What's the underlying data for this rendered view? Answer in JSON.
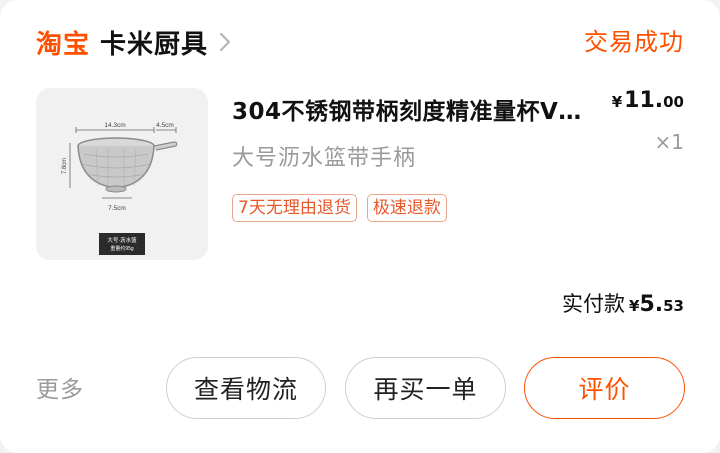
{
  "header": {
    "platform": "淘宝",
    "shop_name": "卡米厨具",
    "order_status": "交易成功"
  },
  "item": {
    "title": "304不锈钢带柄刻度精准量杯V…",
    "spec": "大号沥水篮带手柄",
    "price_currency": "¥",
    "price_int": "11.",
    "price_dec": "00",
    "quantity": "×1",
    "tags": [
      "7天无理由退货",
      "极速退款"
    ],
    "thumbnail": {
      "dim_top_a": "14.3cm",
      "dim_top_b": "4.5cm",
      "dim_side": "7.8cm",
      "dim_bottom": "7.5cm",
      "caption_line1": "大号·沥水篮",
      "caption_line2": "重量约95g"
    }
  },
  "payment": {
    "label": "实付款",
    "currency": "¥",
    "int": "5.",
    "dec": "53"
  },
  "actions": {
    "more": "更多",
    "logistics": "查看物流",
    "rebuy": "再买一单",
    "review": "评价"
  },
  "colors": {
    "brand": "#ff5000",
    "tag_text": "#e8582b",
    "muted": "#9a9a9a"
  }
}
